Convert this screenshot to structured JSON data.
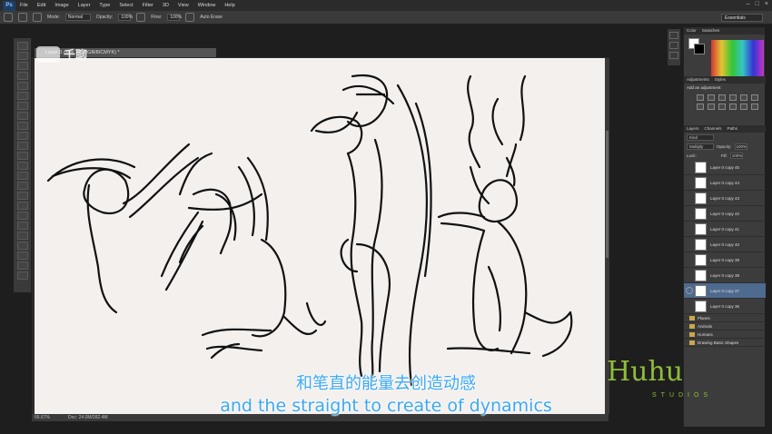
{
  "app": {
    "logo": "Ps",
    "menu": [
      "File",
      "Edit",
      "Image",
      "Layer",
      "Type",
      "Select",
      "Filter",
      "3D",
      "View",
      "Window",
      "Help"
    ]
  },
  "options": {
    "mode_label": "Mode:",
    "mode_value": "Normal",
    "opacity_label": "Opacity:",
    "opacity_value": "100%",
    "flow_label": "Flow:",
    "flow_value": "100%",
    "airbrush_label": "Auto Erase",
    "workspace": "Essentials"
  },
  "document": {
    "tab_title": "Layer 0 copy 37, RGB/8/CMYK) *",
    "zoom": "66.67%",
    "doc_size": "Doc: 24.0M/282.4M"
  },
  "panels": {
    "color_tabs": [
      "Color",
      "Swatches"
    ],
    "adjust_tabs": [
      "Adjustments",
      "Styles"
    ],
    "adjust_title": "Add an adjustment",
    "layer_tabs": [
      "Layers",
      "Channels",
      "Paths"
    ],
    "kind_label": "Kind",
    "blend_mode": "Multiply",
    "opacity_label": "Opacity:",
    "opacity_value": "100%",
    "lock_label": "Lock:",
    "fill_label": "Fill:",
    "fill_value": "100%"
  },
  "layers": [
    {
      "name": "Layer 0 copy 45",
      "visible": false,
      "active": false
    },
    {
      "name": "Layer 0 copy 44",
      "visible": false,
      "active": false
    },
    {
      "name": "Layer 0 copy 43",
      "visible": false,
      "active": false
    },
    {
      "name": "Layer 0 copy 42",
      "visible": false,
      "active": false
    },
    {
      "name": "Layer 0 copy 41",
      "visible": false,
      "active": false
    },
    {
      "name": "Layer 0 copy 40",
      "visible": false,
      "active": false
    },
    {
      "name": "Layer 0 copy 39",
      "visible": false,
      "active": false
    },
    {
      "name": "Layer 0 copy 38",
      "visible": false,
      "active": false
    },
    {
      "name": "Layer 0 copy 37",
      "visible": true,
      "active": true
    },
    {
      "name": "Layer 0 copy 36",
      "visible": false,
      "active": false
    }
  ],
  "groups": [
    "Planes",
    "Animals",
    "Humans",
    "Drawing Basic Shapes"
  ],
  "subtitles": {
    "chinese": "和笔直的能量去创造动感",
    "english": "and the straight to create of dynamics"
  },
  "watermarks": {
    "top_left": "千聊",
    "brand": "Huhu",
    "brand_sub": "STUDIOS"
  }
}
